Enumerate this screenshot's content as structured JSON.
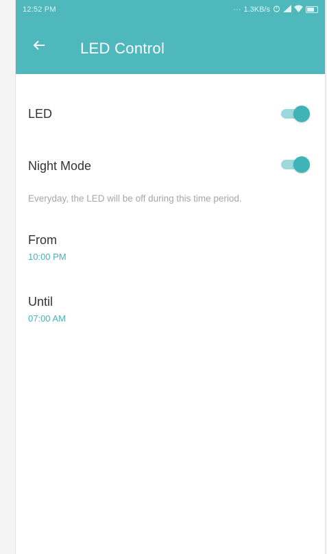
{
  "status_bar": {
    "time": "12:52 PM",
    "network_speed": "1.3KB/s"
  },
  "app_bar": {
    "title": "LED Control",
    "back_icon": "arrow-left-icon"
  },
  "settings": {
    "led": {
      "label": "LED",
      "enabled": true
    },
    "night_mode": {
      "label": "Night Mode",
      "enabled": true,
      "description": "Everyday, the LED will be off during this time period."
    },
    "from": {
      "label": "From",
      "value": "10:00 PM"
    },
    "until": {
      "label": "Until",
      "value": "07:00 AM"
    }
  },
  "colors": {
    "accent": "#4fb8bc",
    "toggle_thumb": "#3fb4b8",
    "toggle_track": "#9bd9da",
    "time_value": "#47b3b7"
  }
}
